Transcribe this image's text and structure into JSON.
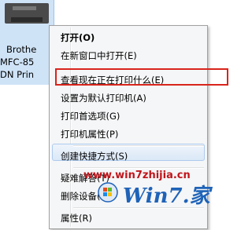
{
  "printer": {
    "label_line1": "Brothe",
    "label_line2": "MFC-85",
    "label_line3": "DN Prin"
  },
  "menu": {
    "items": [
      {
        "label": "打开(O)"
      },
      {
        "label": "在新窗口中打开(E)"
      },
      {
        "label": "查看现在正在打印什么(E)"
      },
      {
        "label": "设置为默认打印机(A)"
      },
      {
        "label": "打印首选项(G)"
      },
      {
        "label": "打印机属性(P)"
      },
      {
        "label": "创建快捷方式(S)"
      },
      {
        "label": "疑难解答(T)"
      },
      {
        "label": "删除设备(V)"
      },
      {
        "label": "属性(R)"
      }
    ]
  },
  "watermark": {
    "url": "www.win7zhijia.cn",
    "logo_text": "Win7.家"
  },
  "colors": {
    "highlight_border": "#d9241c",
    "watermark_red": "#c0151b",
    "watermark_blue": "#1f63b8",
    "menu_bg": "#f5f6f7"
  }
}
